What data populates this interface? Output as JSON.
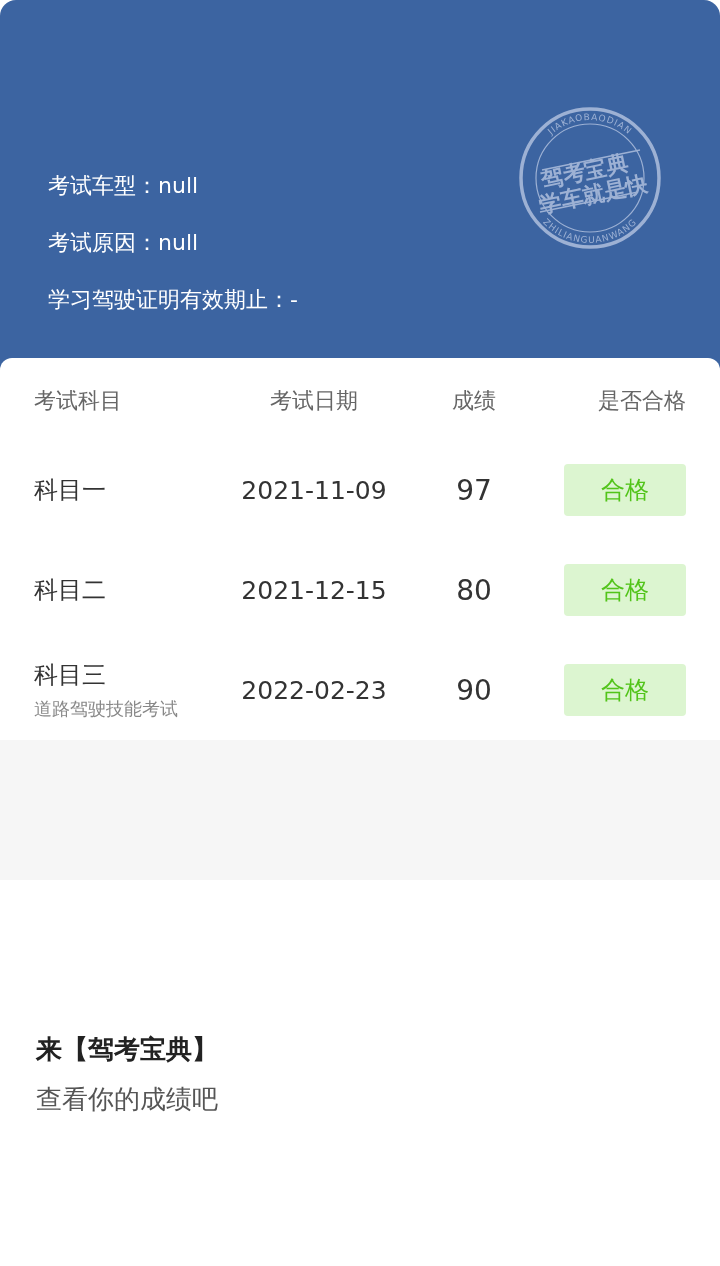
{
  "header": {
    "info": [
      "考试车型：null",
      "考试原因：null",
      "学习驾驶证明有效期止：-"
    ]
  },
  "stamp": {
    "top_text": "JIAKAOBAODIAN",
    "line_1": "驾考宝典",
    "line_2": "学车就是快",
    "bottom_text": "ZHILIANGUANWANG"
  },
  "table": {
    "columns": [
      "考试科目",
      "考试日期",
      "成绩",
      "是否合格"
    ],
    "rows": [
      {
        "subject": "科目一",
        "date": "2021-11-09",
        "score": "97",
        "result": "合格",
        "passed": true
      },
      {
        "subject": "科目二",
        "date": "2021-12-15",
        "score": "80",
        "result": "合格",
        "passed": true
      },
      {
        "subject": "科目三",
        "note": "道路驾驶技能考试",
        "date": "2022-02-23",
        "score": "90",
        "result": "合格",
        "passed": true
      }
    ]
  },
  "promo": {
    "title": "来【驾考宝典】",
    "subtitle": "查看你的成绩吧"
  }
}
